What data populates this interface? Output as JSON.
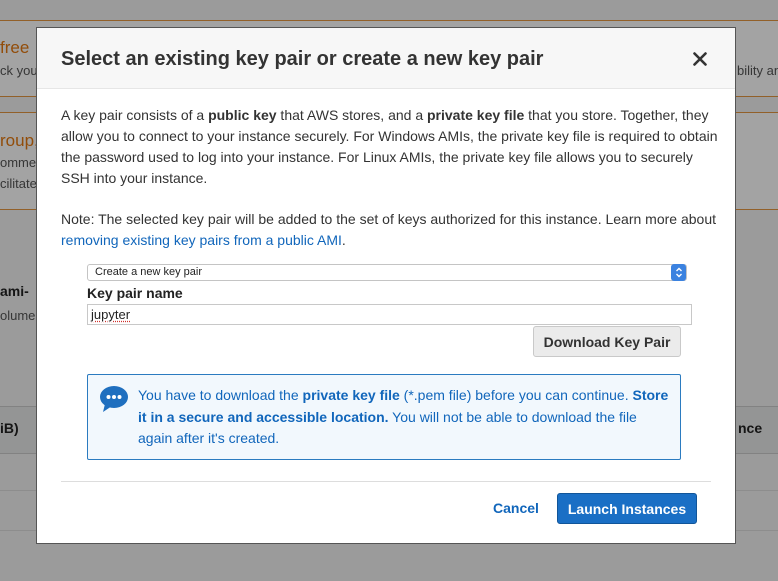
{
  "background": {
    "free_label": "free",
    "check_text": "ck you",
    "ability_text": "bility an",
    "group_label": "roup,",
    "comment_text": "omme",
    "facilitate_text": "cilitate",
    "ami_text": "ami-",
    "volume_text": "olume",
    "ib_header": "iB)",
    "ance_header": "nce"
  },
  "modal": {
    "title": "Select an existing key pair or create a new key pair",
    "close_icon": "close-icon",
    "intro": {
      "part1": "A key pair consists of a ",
      "public_key": "public key",
      "part2": " that AWS stores, and a ",
      "private_key_file": "private key file",
      "part3": " that you store. Together, they allow you to connect to your instance securely. For Windows AMIs, the private key file is required to obtain the password used to log into your instance. For Linux AMIs, the private key file allows you to securely SSH into your instance."
    },
    "note": {
      "part1": "Note: The selected key pair will be added to the set of keys authorized for this instance. Learn more about ",
      "link": "removing existing key pairs from a public AMI",
      "part2": "."
    },
    "key_pair_select": {
      "selected": "Create a new key pair"
    },
    "key_pair_name_label": "Key pair name",
    "key_pair_name_value": "jupyter",
    "download_button": "Download Key Pair",
    "info": {
      "icon": "chat-bubble-icon",
      "part1": "You have to download the ",
      "private_key_file": "private key file",
      "part2": " (*.pem file) before you can continue. ",
      "store_bold": "Store it in a secure and accessible location.",
      "part3": " You will not be able to download the file again after it's created."
    },
    "cancel_button": "Cancel",
    "launch_button": "Launch Instances",
    "colors": {
      "primary": "#1a6fc5",
      "link": "#1166bb",
      "info_border": "#2b7bc0"
    }
  }
}
